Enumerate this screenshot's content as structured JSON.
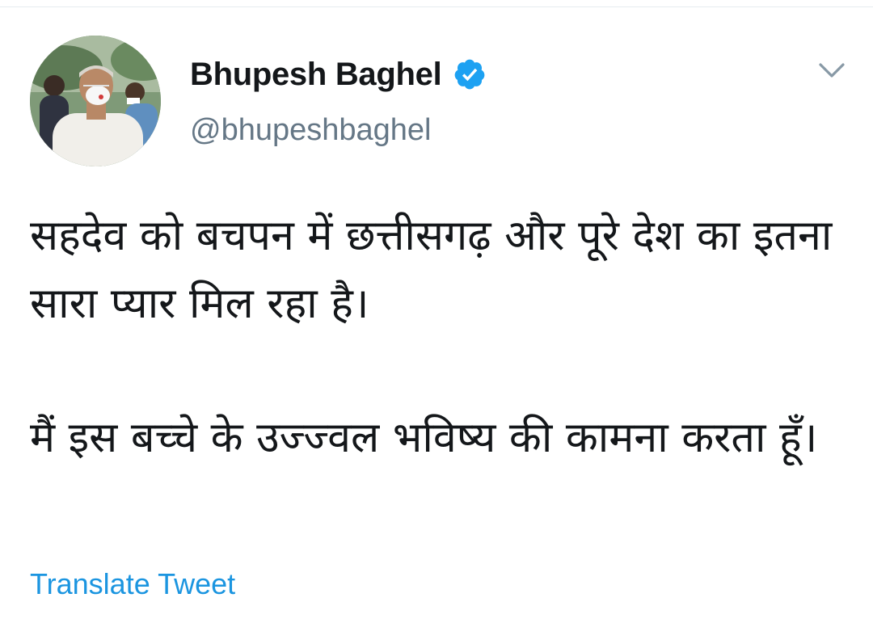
{
  "author": {
    "name": "Bhupesh Baghel",
    "handle": "@bhupeshbaghel",
    "verified": true,
    "avatar_icon": "profile-photo"
  },
  "menu": {
    "icon": "chevron-down-icon"
  },
  "tweet": {
    "paragraphs": [
      "सहदेव को बचपन में छत्तीसगढ़ और पूरे देश का इतना सारा प्यार मिल रहा है।",
      "मैं इस बच्चे के उज्ज्वल भविष्य की कामना करता हूँ।"
    ]
  },
  "actions": {
    "translate_label": "Translate Tweet"
  },
  "colors": {
    "text": "#14171a",
    "secondary": "#657786",
    "accent": "#1b95e0",
    "verified_badge": "#1da1f2"
  }
}
